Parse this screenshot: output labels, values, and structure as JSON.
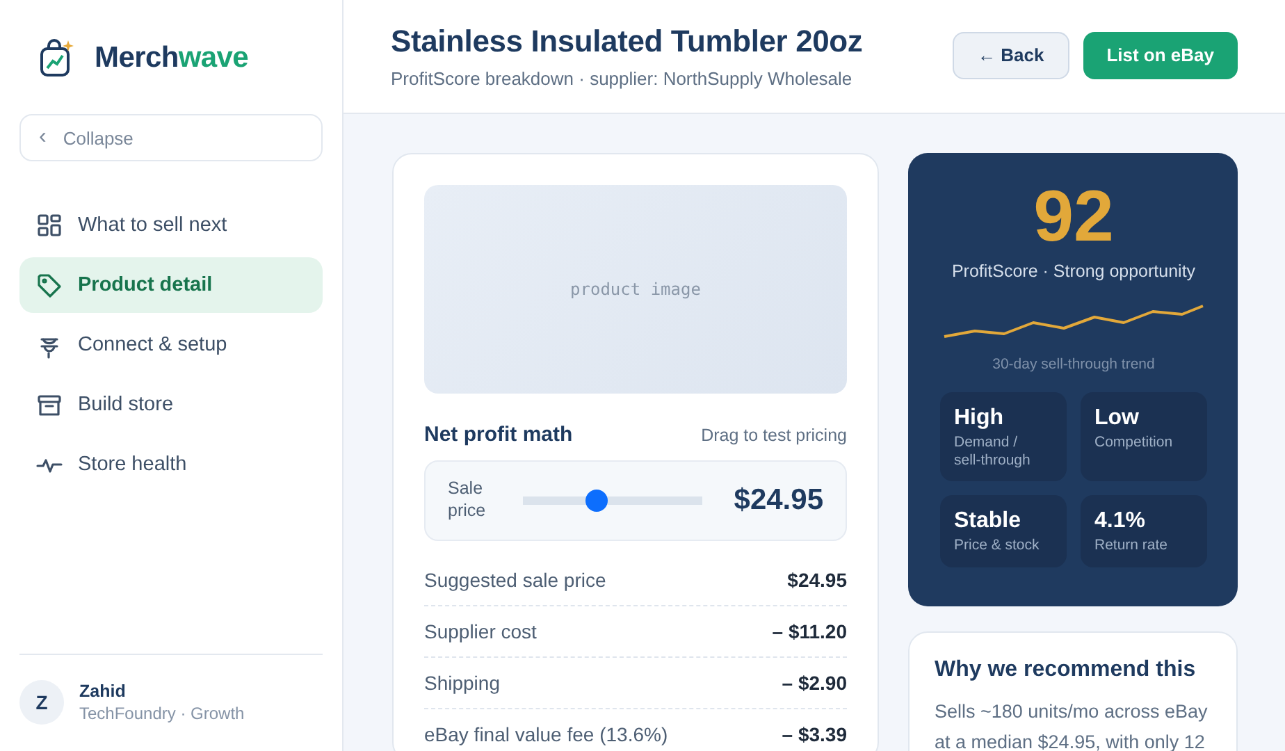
{
  "brand": {
    "name_part_1": "Merch",
    "name_part_2": "wave"
  },
  "collapse": {
    "icon": "‹",
    "label": "Collapse"
  },
  "sidebar": {
    "items": [
      {
        "label": "What to sell next",
        "selected": false
      },
      {
        "label": "Product detail",
        "selected": true
      },
      {
        "label": "Connect & setup",
        "selected": false
      },
      {
        "label": "Build store",
        "selected": false
      },
      {
        "label": "Store health",
        "selected": false
      }
    ]
  },
  "user": {
    "initial": "Z",
    "name": "Zahid",
    "detail": "TechFoundry · Growth"
  },
  "header": {
    "title": "Stainless Insulated Tumbler 20oz",
    "subtitle": "ProfitScore breakdown · supplier: NorthSupply Wholesale",
    "back_button": "← Back",
    "primary_button": "List on eBay"
  },
  "product_image": {
    "label": "product image"
  },
  "profit_math": {
    "title": "Net profit math",
    "hint": "Drag to test pricing",
    "slider": {
      "label": "Sale price",
      "level": 0.41,
      "reading": "$24.95"
    },
    "rows": [
      {
        "label": "Suggested sale price",
        "value": "$24.95"
      },
      {
        "label": "Supplier cost",
        "value": "– $11.20"
      },
      {
        "label": "Shipping",
        "value": "– $2.90"
      },
      {
        "label": "eBay final value fee (13.6%)",
        "value": "– $3.39"
      }
    ]
  },
  "score": {
    "value": "92",
    "caption": "ProfitScore · Strong opportunity",
    "trend_label": "30-day sell-through trend",
    "tiles": [
      {
        "value": "High",
        "label": "Demand / sell-through"
      },
      {
        "value": "Low",
        "label": "Competition"
      },
      {
        "value": "Stable",
        "label": "Price & stock"
      },
      {
        "value": "4.1%",
        "label": "Return rate"
      }
    ]
  },
  "why": {
    "title": "Why we recommend this",
    "text": "Sells ~180 units/mo across eBay at a median $24.95, with only 12"
  }
}
